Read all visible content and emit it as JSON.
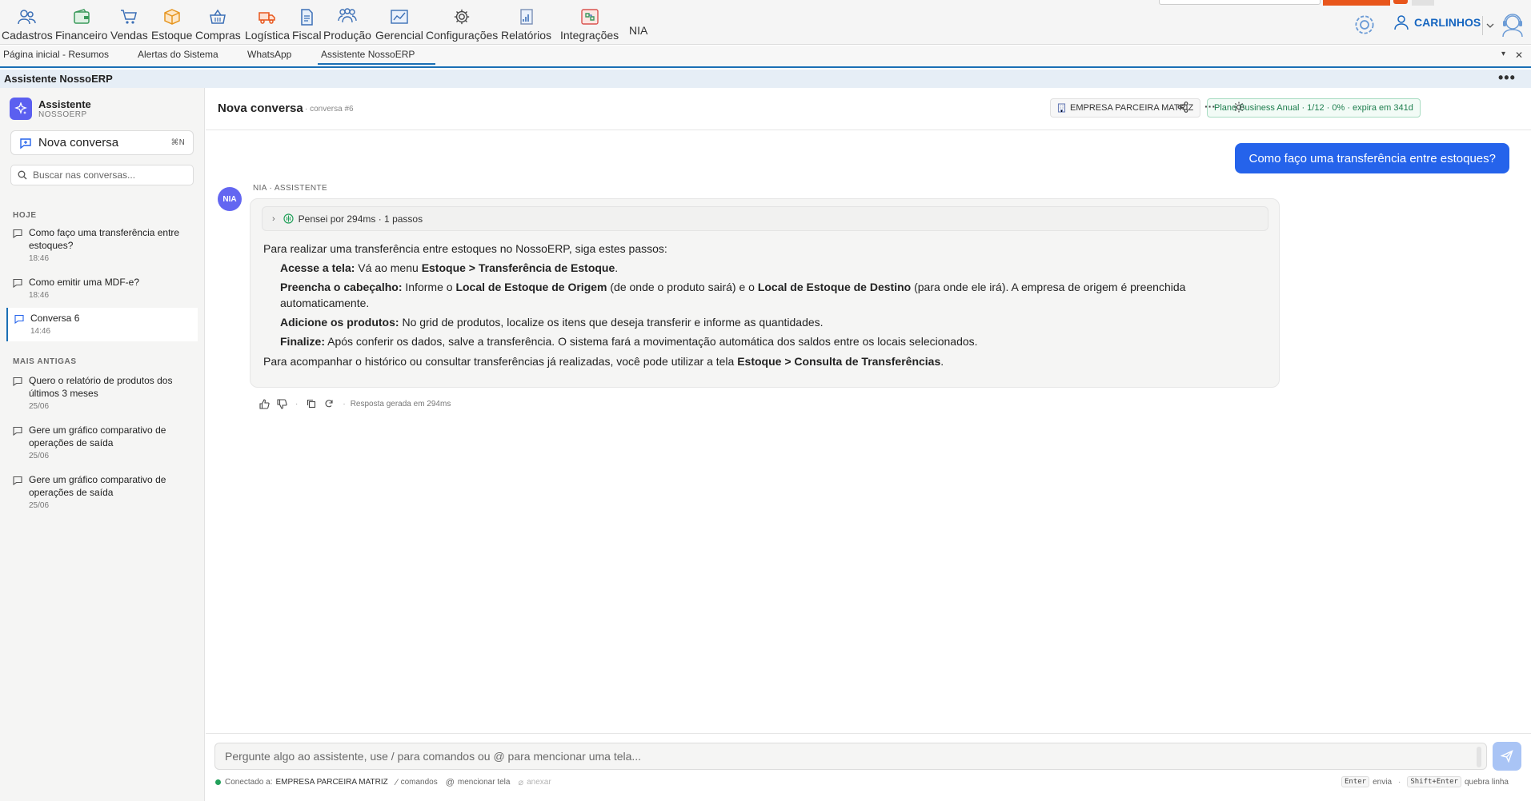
{
  "menu": {
    "items": [
      {
        "label": "Cadastros",
        "icon": "people-icon"
      },
      {
        "label": "Financeiro",
        "icon": "wallet-icon"
      },
      {
        "label": "Vendas",
        "icon": "cart-icon"
      },
      {
        "label": "Estoque",
        "icon": "box-icon"
      },
      {
        "label": "Compras",
        "icon": "basket-icon"
      },
      {
        "label": "Logística",
        "icon": "truck-icon"
      },
      {
        "label": "Fiscal",
        "icon": "document-icon"
      },
      {
        "label": "Produção",
        "icon": "team-icon"
      },
      {
        "label": "Gerencial",
        "icon": "chart-icon"
      },
      {
        "label": "Configurações",
        "icon": "gear-icon"
      },
      {
        "label": "Relatórios",
        "icon": "report-icon"
      },
      {
        "label": "Integrações",
        "icon": "integration-icon"
      }
    ],
    "nia": "NIA",
    "user": "CARLINHOS"
  },
  "tabs": [
    {
      "label": "Página inicial - Resumos"
    },
    {
      "label": "Alertas do Sistema"
    },
    {
      "label": "WhatsApp"
    },
    {
      "label": "Assistente NossoERP"
    }
  ],
  "title_bar": {
    "title": "Assistente NossoERP",
    "more": "•••"
  },
  "sidebar": {
    "brand_title": "Assistente",
    "brand_sub": "NOSSOERP",
    "new_conversation": "Nova conversa",
    "shortcut": "⌘N",
    "search_placeholder": "Buscar nas conversas...",
    "section_today": "HOJE",
    "section_older": "MAIS ANTIGAS",
    "today": [
      {
        "title": "Como faço uma transferência entre estoques?",
        "time": "18:46"
      },
      {
        "title": "Como emitir uma MDF-e?",
        "time": "18:46"
      },
      {
        "title": "Conversa 6",
        "time": "14:46"
      }
    ],
    "older": [
      {
        "title": "Quero o relatório de produtos dos últimos 3 meses",
        "time": "25/06"
      },
      {
        "title": "Gere um gráfico comparativo de operações de saída",
        "time": "25/06"
      },
      {
        "title": "Gere um gráfico comparativo de operações de saída",
        "time": "25/06"
      }
    ]
  },
  "header": {
    "title": "Nova conversa",
    "subtitle": "· conversa #6",
    "company": "EMPRESA PARCEIRA MATRIZ",
    "plan": "Plano Business Anual · 1/12 · 0% · expira em 341d"
  },
  "chat": {
    "user_message": "Como faço uma transferência entre estoques?",
    "avatar": "NIA",
    "assistant_label": "NIA · ASSISTENTE",
    "thinking": "Pensei por 294ms · 1 passos",
    "intro": "Para realizar uma transferência entre estoques no NossoERP, siga estes passos:",
    "steps": {
      "s1_label": "Acesse a tela:",
      "s1_text": " Vá ao menu ",
      "s1_bold": "Estoque > Transferência de Estoque",
      "s1_end": ".",
      "s2_label": "Preencha o cabeçalho:",
      "s2_a": " Informe o ",
      "s2_b": "Local de Estoque de Origem",
      "s2_c": " (de onde o produto sairá) e o ",
      "s2_d": "Local de Estoque de Destino",
      "s2_e": " (para onde ele irá). A empresa de origem é preenchida automaticamente.",
      "s3_label": "Adicione os produtos:",
      "s3_text": " No grid de produtos, localize os itens que deseja transferir e informe as quantidades.",
      "s4_label": "Finalize:",
      "s4_text": " Após conferir os dados, salve a transferência. O sistema fará a movimentação automática dos saldos entre os locais selecionados."
    },
    "outro": "Para acompanhar o histórico ou consultar transferências já realizadas, você pode utilizar a tela ",
    "outro_bold": "Estoque > Consulta de Transferências",
    "outro_end": ".",
    "generated": "Resposta gerada em 294ms",
    "sep": "·"
  },
  "composer": {
    "placeholder": "Pergunte algo ao assistente, use / para comandos ou @ para mencionar uma tela...",
    "connected_label": "Conectado a:",
    "connected_company": "EMPRESA PARCEIRA MATRIZ",
    "commands": "comandos",
    "mention": "mencionar tela",
    "attach": "anexar",
    "enter_key": "Enter",
    "enter_action": "envia",
    "shift_key": "Shift+Enter",
    "shift_action": "quebra linha"
  },
  "colors": {
    "accent": "#2563eb",
    "brand": "#1a6fb5",
    "avatar": "#6366f1",
    "orange": "#e8561c"
  }
}
